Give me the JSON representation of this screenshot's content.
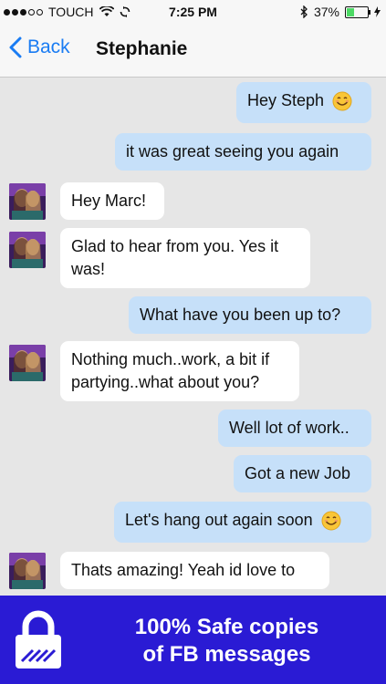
{
  "status_bar": {
    "carrier": "TOUCH",
    "time": "7:25 PM",
    "battery_percent": "37%",
    "battery_level": 0.37
  },
  "nav": {
    "back_label": "Back",
    "title": "Stephanie",
    "accent_color": "#1a7cf3"
  },
  "messages": [
    {
      "direction": "out",
      "text": "Hey Steph",
      "emoji": "smiley-face-icon"
    },
    {
      "direction": "out",
      "text": "it was great seeing you again"
    },
    {
      "direction": "in",
      "text": "Hey Marc!"
    },
    {
      "direction": "in",
      "text": "Glad to hear from you. Yes it was!"
    },
    {
      "direction": "out",
      "text": "What have you been up to?"
    },
    {
      "direction": "in",
      "text": "Nothing much..work, a bit if partying..what about you?"
    },
    {
      "direction": "out",
      "text": "Well lot of work.."
    },
    {
      "direction": "out",
      "text": "Got a new Job"
    },
    {
      "direction": "out",
      "text": "Let's hang out again soon",
      "emoji": "smiley-face-icon"
    },
    {
      "direction": "in",
      "text": "Thats amazing! Yeah id love to"
    }
  ],
  "banner": {
    "line1": "100% Safe copies",
    "line2": "of FB messages",
    "background_color": "#2a1bd4"
  }
}
